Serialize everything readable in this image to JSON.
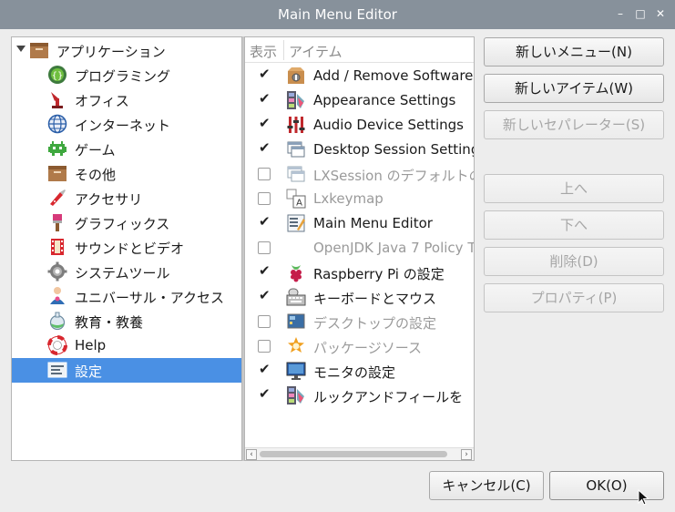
{
  "window": {
    "title": "Main Menu Editor",
    "controls": {
      "minimize": "–",
      "maximize": "□",
      "close": "✕"
    }
  },
  "tree": {
    "root": {
      "label": "アプリケーション",
      "icon": "folder-icon",
      "expanded": true
    },
    "items": [
      {
        "label": "プログラミング",
        "icon": "programming-icon"
      },
      {
        "label": "オフィス",
        "icon": "office-icon"
      },
      {
        "label": "インターネット",
        "icon": "globe-icon"
      },
      {
        "label": "ゲーム",
        "icon": "game-icon"
      },
      {
        "label": "その他",
        "icon": "folder-icon"
      },
      {
        "label": "アクセサリ",
        "icon": "knife-icon"
      },
      {
        "label": "グラフィックス",
        "icon": "paintbrush-icon"
      },
      {
        "label": "サウンドとビデオ",
        "icon": "film-icon"
      },
      {
        "label": "システムツール",
        "icon": "gear-icon"
      },
      {
        "label": "ユニバーサル・アクセス",
        "icon": "accessibility-icon"
      },
      {
        "label": "教育・教養",
        "icon": "flask-icon"
      },
      {
        "label": "Help",
        "icon": "lifebuoy-icon"
      },
      {
        "label": "設定",
        "icon": "settings-icon",
        "selected": true
      }
    ]
  },
  "list": {
    "header": {
      "show": "表示",
      "item": "アイテム"
    },
    "rows": [
      {
        "checked": true,
        "label": "Add / Remove Software",
        "icon": "package-icon"
      },
      {
        "checked": true,
        "label": "Appearance Settings",
        "icon": "appearance-icon"
      },
      {
        "checked": true,
        "label": "Audio Device Settings",
        "icon": "mixer-icon"
      },
      {
        "checked": true,
        "label": "Desktop Session Settings",
        "icon": "window-icon"
      },
      {
        "checked": false,
        "label": "LXSession のデフォルトの",
        "icon": "window-icon"
      },
      {
        "checked": false,
        "label": "Lxkeymap",
        "icon": "keymap-icon"
      },
      {
        "checked": true,
        "label": "Main Menu Editor",
        "icon": "menu-editor-icon"
      },
      {
        "checked": false,
        "label": "OpenJDK Java 7 Policy T",
        "icon": ""
      },
      {
        "checked": true,
        "label": "Raspberry Pi の設定",
        "icon": "raspberry-icon"
      },
      {
        "checked": true,
        "label": "キーボードとマウス",
        "icon": "keyboard-icon"
      },
      {
        "checked": false,
        "label": "デスクトップの設定",
        "icon": "desktop-icon"
      },
      {
        "checked": false,
        "label": "パッケージソース",
        "icon": "star-gear-icon"
      },
      {
        "checked": true,
        "label": "モニタの設定",
        "icon": "monitor-icon"
      },
      {
        "checked": true,
        "label": "ルックアンドフィールを",
        "icon": "appearance-icon"
      }
    ],
    "check_glyph": "✔"
  },
  "buttons": {
    "new_menu": "新しいメニュー(N)",
    "new_item": "新しいアイテム(W)",
    "new_separator": "新しいセパレーター(S)",
    "up": "上へ",
    "down": "下へ",
    "delete": "削除(D)",
    "properties": "プロパティ(P)",
    "cancel": "キャンセル(C)",
    "ok": "OK(O)"
  },
  "colors": {
    "selection": "#4a90e4",
    "titlebar": "#87919b"
  }
}
